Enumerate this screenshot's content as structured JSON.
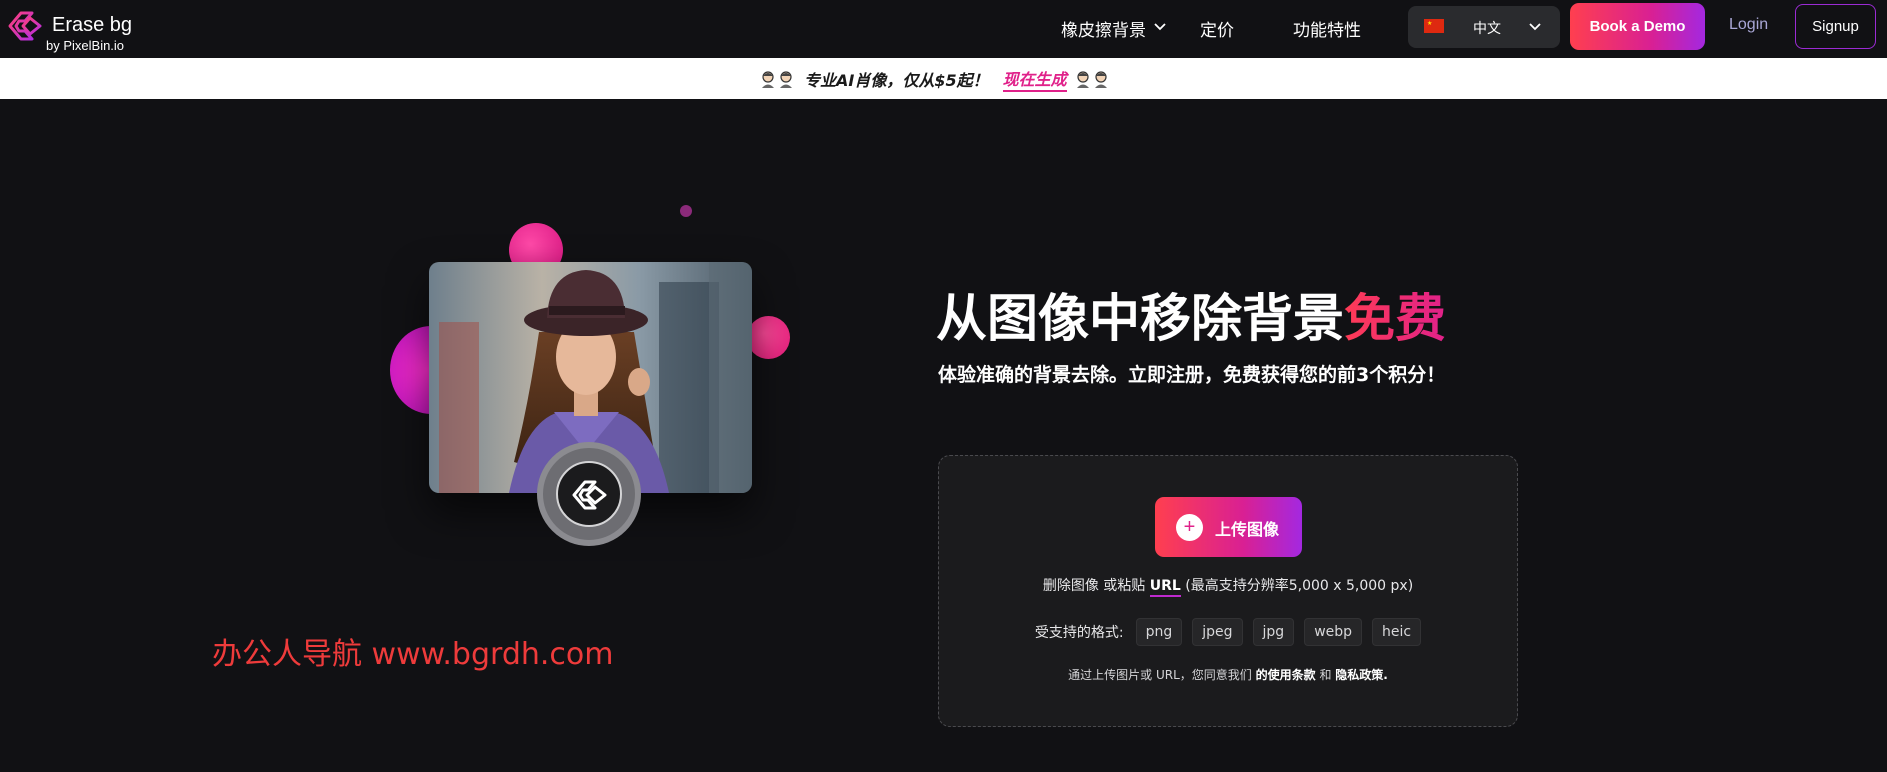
{
  "header": {
    "logo_title": "Erase bg",
    "logo_byline": "by PixelBin.io",
    "nav": [
      {
        "label": "橡皮擦背景",
        "has_dropdown": true
      },
      {
        "label": "定价"
      },
      {
        "label": "功能特性"
      }
    ],
    "language": {
      "flag": "cn-flag-icon",
      "label": "中文"
    },
    "book_demo_label": "Book a Demo",
    "login_label": "Login",
    "signup_label": "Signup"
  },
  "promo": {
    "text": "专业AI肖像，仅从$5起！",
    "link": "现在生成"
  },
  "hero": {
    "title_main": "从图像中移除背景",
    "title_accent": "免费",
    "subtitle": "体验准确的背景去除。立即注册，免费获得您的前3个积分！",
    "watermark": "办公人导航 www.bgrdh.com"
  },
  "upload": {
    "button_label": "上传图像",
    "paste_prefix": "删除图像 或粘贴",
    "paste_url": "URL",
    "paste_suffix": "(最高支持分辨率5,000 x 5,000 px)",
    "formats_label": "受支持的格式:",
    "formats": [
      "png",
      "jpeg",
      "jpg",
      "webp",
      "heic"
    ],
    "terms_prefix": "通过上传图片或 URL，您同意我们",
    "terms_link": "的使用条款",
    "terms_and": "和",
    "privacy_link": "隐私政策."
  },
  "colors": {
    "background": "#111114",
    "accent_pink": "#e0218a",
    "accent_red": "#ff3f4f",
    "accent_purple": "#a428e0"
  }
}
